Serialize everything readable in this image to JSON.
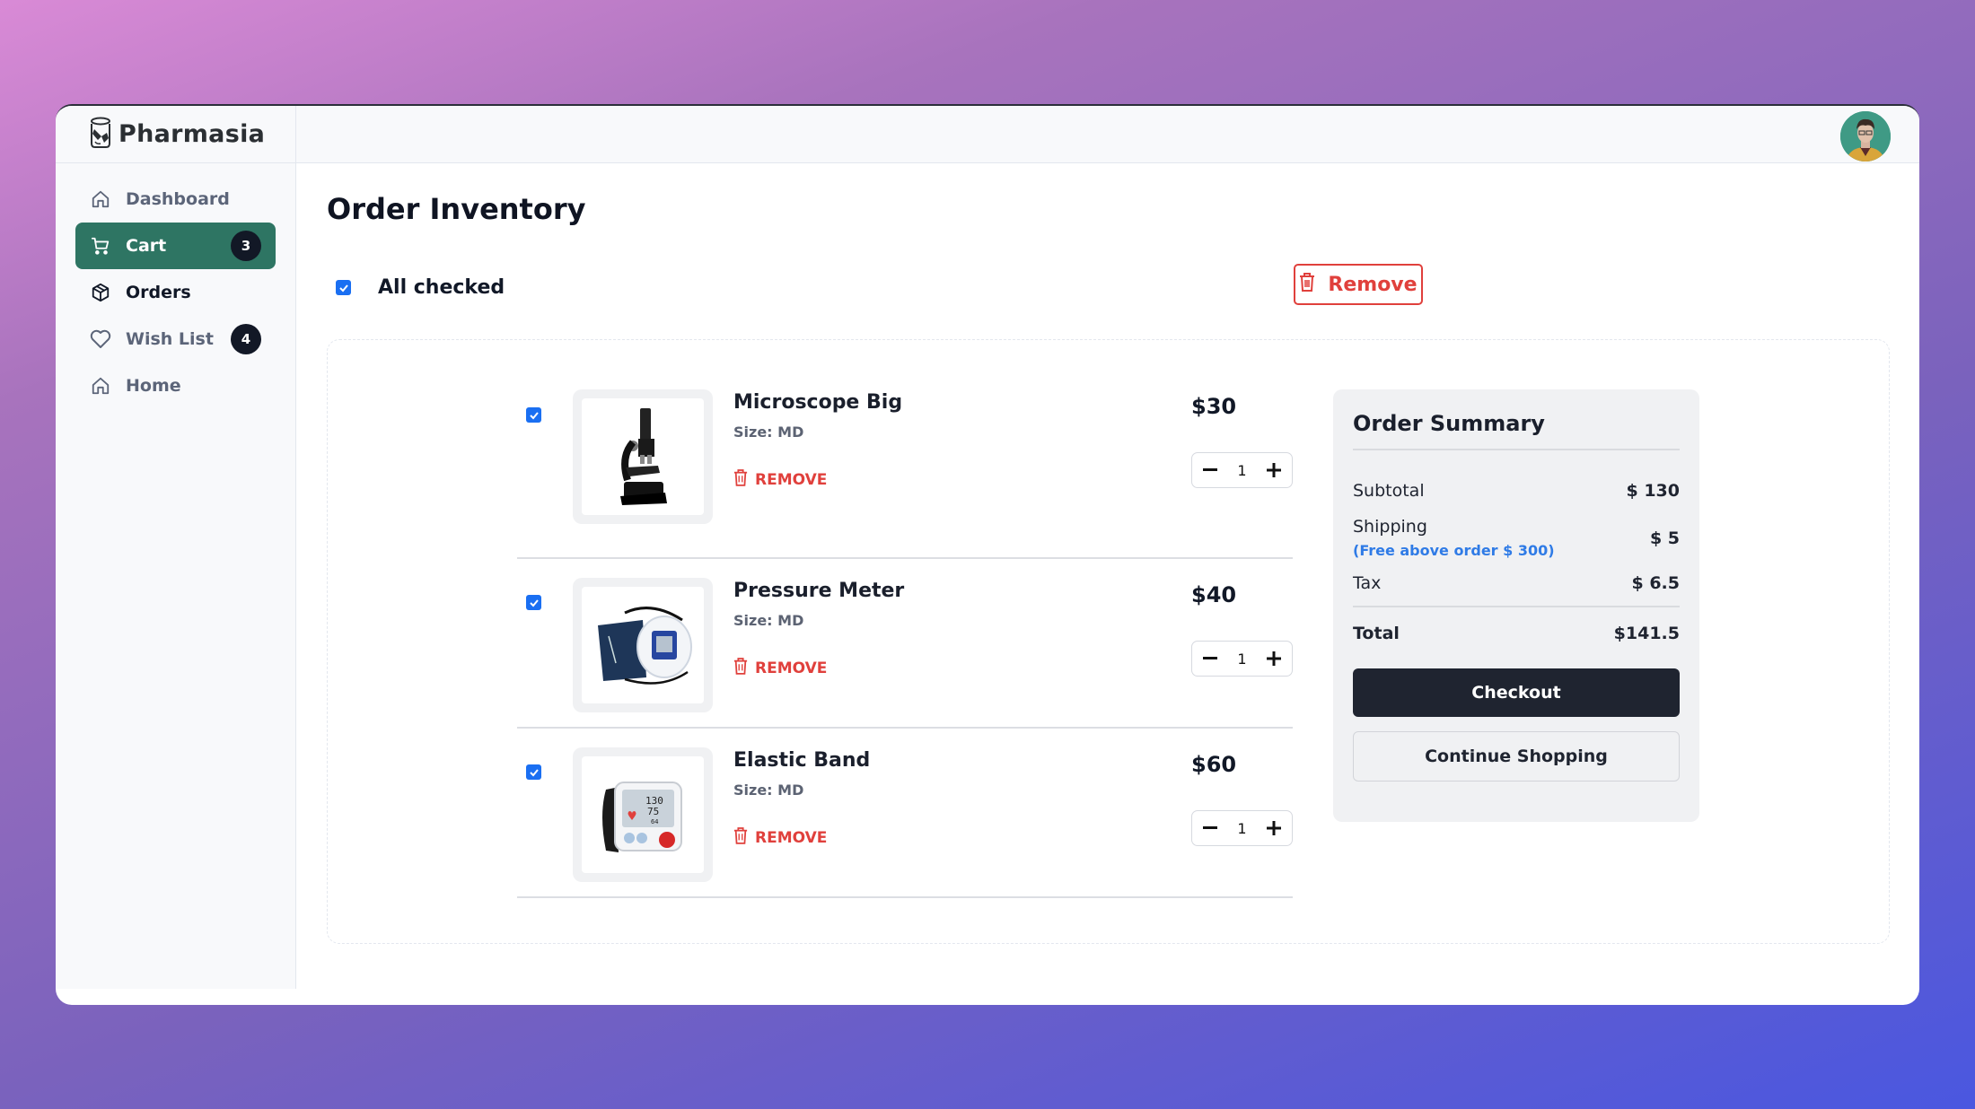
{
  "app": {
    "brand": "Pharmasia"
  },
  "sidebar": {
    "items": [
      {
        "label": "Dashboard",
        "icon": "home-icon"
      },
      {
        "label": "Cart",
        "icon": "cart-icon",
        "badge": "3",
        "active": true
      },
      {
        "label": "Orders",
        "icon": "box-icon"
      },
      {
        "label": "Wish List",
        "icon": "heart-icon",
        "badge": "4"
      },
      {
        "label": "Home",
        "icon": "home-icon"
      }
    ]
  },
  "header": {
    "avatar": "user-avatar"
  },
  "main": {
    "title": "Order Inventory",
    "all_checked_label": "All checked",
    "all_checked": true,
    "remove_label": "Remove"
  },
  "cart": {
    "items": [
      {
        "name": "Microscope Big",
        "size": "Size: MD",
        "remove_label": "REMOVE",
        "price": "$30",
        "quantity": "1",
        "checked": true,
        "image": "microscope"
      },
      {
        "name": "Pressure Meter",
        "size": "Size: MD",
        "remove_label": "REMOVE",
        "price": "$40",
        "quantity": "1",
        "checked": true,
        "image": "blood-pressure-cuff"
      },
      {
        "name": "Elastic Band",
        "size": "Size: MD",
        "remove_label": "REMOVE",
        "price": "$60",
        "quantity": "1",
        "checked": true,
        "image": "wrist-bp-monitor"
      }
    ]
  },
  "summary": {
    "title": "Order Summary",
    "subtotal_label": "Subtotal",
    "subtotal": "$ 130",
    "shipping_label": "Shipping",
    "shipping_note": "(Free above order $ 300)",
    "shipping": "$ 5",
    "tax_label": "Tax",
    "tax": "$ 6.5",
    "total_label": "Total",
    "total": "$141.5",
    "checkout_label": "Checkout",
    "continue_label": "Continue Shopping"
  },
  "colors": {
    "accent": "#2e7563",
    "danger": "#e0403c",
    "link": "#2f7be6",
    "primary_dark": "#1f2430",
    "checkbox": "#1a6ff2"
  }
}
